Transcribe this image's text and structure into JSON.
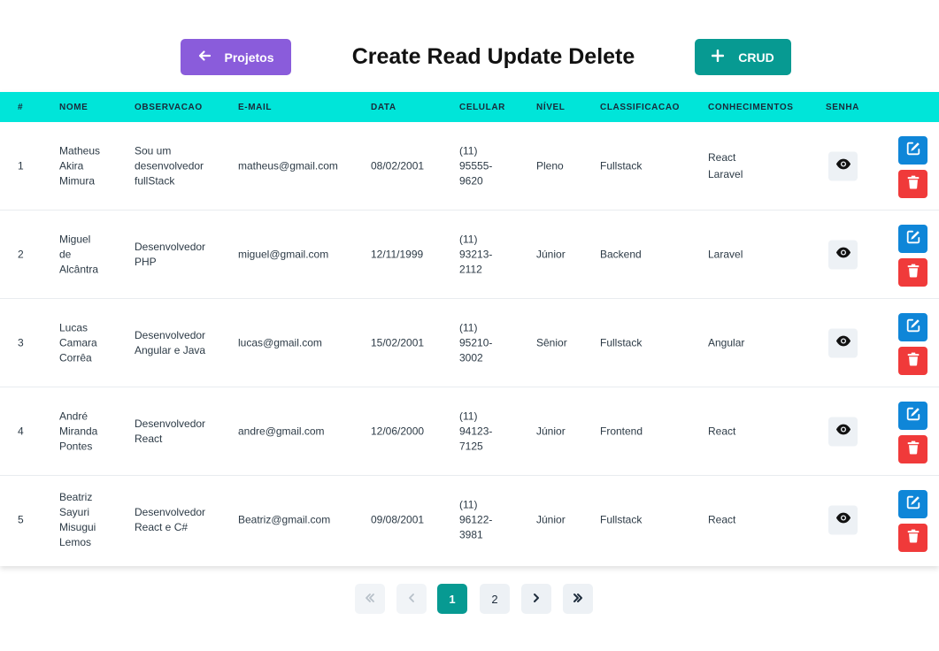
{
  "header": {
    "back_label": "Projetos",
    "title": "Create Read Update Delete",
    "crud_label": "CRUD"
  },
  "table": {
    "columns": [
      "#",
      "NOME",
      "OBSERVACAO",
      "E-MAIL",
      "DATA",
      "CELULAR",
      "NÍVEL",
      "CLASSIFICACAO",
      "CONHECIMENTOS",
      "SENHA"
    ],
    "rows": [
      {
        "id": "1",
        "nome": [
          "Matheus",
          "Akira",
          "Mimura"
        ],
        "obs": [
          "Sou um",
          "desenvolvedor",
          "fullStack"
        ],
        "email": "matheus@gmail.com",
        "data": "08/02/2001",
        "celular": [
          "(11)",
          "95555-",
          "9620"
        ],
        "nivel": "Pleno",
        "classificacao": "Fullstack",
        "conhecimentos": [
          "React",
          "Laravel"
        ]
      },
      {
        "id": "2",
        "nome": [
          "Miguel",
          "de",
          "Alcântra"
        ],
        "obs": [
          "Desenvolvedor",
          "PHP"
        ],
        "email": "miguel@gmail.com",
        "data": "12/11/1999",
        "celular": [
          "(11)",
          "93213-",
          "2112"
        ],
        "nivel": "Júnior",
        "classificacao": "Backend",
        "conhecimentos": [
          "Laravel"
        ]
      },
      {
        "id": "3",
        "nome": [
          "Lucas",
          "Camara",
          "Corrêa"
        ],
        "obs": [
          "Desenvolvedor",
          "Angular e Java"
        ],
        "email": "lucas@gmail.com",
        "data": "15/02/2001",
        "celular": [
          "(11)",
          "95210-",
          "3002"
        ],
        "nivel": "Sênior",
        "classificacao": "Fullstack",
        "conhecimentos": [
          "Angular"
        ]
      },
      {
        "id": "4",
        "nome": [
          "André",
          "Miranda",
          "Pontes"
        ],
        "obs": [
          "Desenvolvedor",
          "React"
        ],
        "email": "andre@gmail.com",
        "data": "12/06/2000",
        "celular": [
          "(11)",
          "94123-",
          "7125"
        ],
        "nivel": "Júnior",
        "classificacao": "Frontend",
        "conhecimentos": [
          "React"
        ]
      },
      {
        "id": "5",
        "nome": [
          "Beatriz",
          "Sayuri",
          "Misugui",
          "Lemos"
        ],
        "obs": [
          "Desenvolvedor",
          "React e C#"
        ],
        "email": "Beatriz@gmail.com",
        "data": "09/08/2001",
        "celular": [
          "(11)",
          "96122-",
          "3981"
        ],
        "nivel": "Júnior",
        "classificacao": "Fullstack",
        "conhecimentos": [
          "React"
        ]
      }
    ]
  },
  "pagination": {
    "pages": [
      "1",
      "2"
    ],
    "current": "1"
  },
  "colors": {
    "header_bg": "#00e5d9",
    "projetos_btn": "#8a5cdb",
    "crud_btn": "#079a92",
    "edit_btn": "#0f86d8",
    "delete_btn": "#f03a3a"
  },
  "icons": {
    "back": "arrow-left-icon",
    "crud": "plus-icon",
    "senha": "eye-icon",
    "edit": "edit-icon",
    "delete": "trash-icon",
    "first": "double-chevron-left-icon",
    "prev": "chevron-left-icon",
    "next": "chevron-right-icon",
    "last": "double-chevron-right-icon"
  }
}
